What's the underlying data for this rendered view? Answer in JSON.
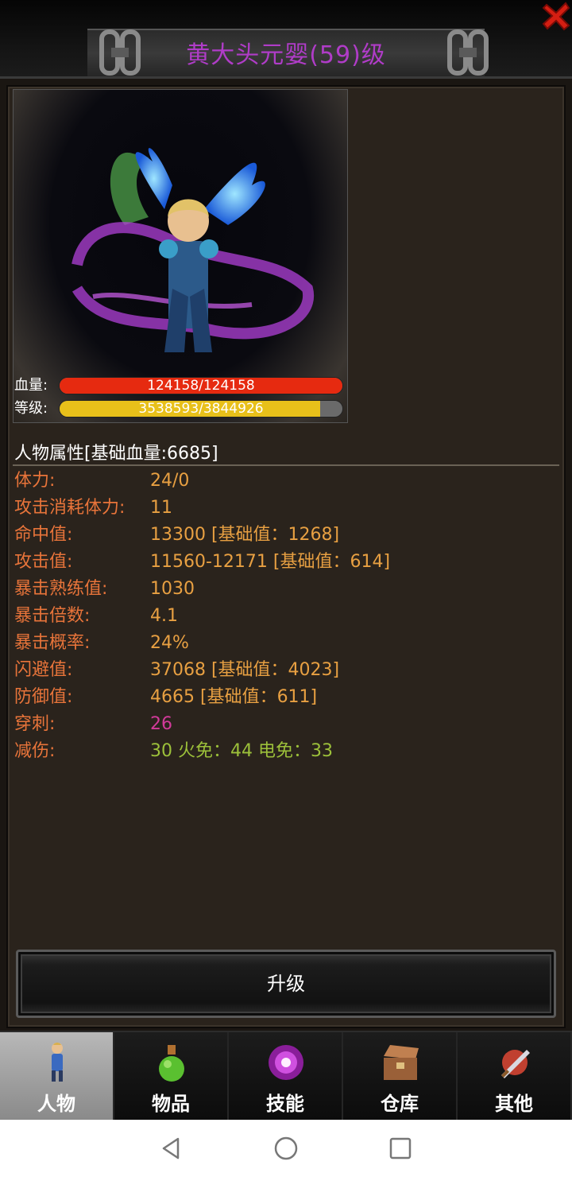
{
  "header": {
    "title": "黄大头元婴(59)级",
    "close_icon": "close-x-icon"
  },
  "portrait": {
    "hp_label": "血量:",
    "hp_text": "124158/124158",
    "hp_fraction": 1.0,
    "level_label": "等级:",
    "exp_text": "3538593/3844926",
    "exp_fraction": 0.92,
    "colors": {
      "hp": "#e62a10",
      "exp": "#e8c01a"
    }
  },
  "attributes": {
    "title": "人物属性[基础血量:6685]",
    "rows": [
      {
        "label": "体力:",
        "value": "24/0",
        "color": "#e8a042"
      },
      {
        "label": "攻击消耗体力:",
        "value": "11",
        "color": "#e8a042"
      },
      {
        "label": "命中值:",
        "value": "13300 [基础值：1268]",
        "color": "#e8a042"
      },
      {
        "label": "攻击值:",
        "value": "11560-12171 [基础值：614]",
        "color": "#e8a042"
      },
      {
        "label": "暴击熟练值:",
        "value": "1030",
        "color": "#e8a042"
      },
      {
        "label": "暴击倍数:",
        "value": "4.1",
        "color": "#e8a042"
      },
      {
        "label": "暴击概率:",
        "value": "24%",
        "color": "#e8a042"
      },
      {
        "label": "闪避值:",
        "value": "37068 [基础值：4023]",
        "color": "#e8a042"
      },
      {
        "label": "防御值:",
        "value": "4665 [基础值：611]",
        "color": "#e8a042"
      },
      {
        "label": "穿刺:",
        "value": "26",
        "color": "#d23a9a"
      },
      {
        "label": "减伤:",
        "value": "30 火免：44 电免：33",
        "color": "#9cc03a"
      }
    ]
  },
  "upgrade_button": {
    "label": "升级"
  },
  "tabs": [
    {
      "label": "人物",
      "icon": "character-icon",
      "active": true
    },
    {
      "label": "物品",
      "icon": "potion-icon",
      "active": false
    },
    {
      "label": "技能",
      "icon": "skill-orb-icon",
      "active": false
    },
    {
      "label": "仓库",
      "icon": "chest-icon",
      "active": false
    },
    {
      "label": "其他",
      "icon": "sword-icon",
      "active": false
    }
  ],
  "system_nav": {
    "back": "back-icon",
    "home": "home-icon",
    "recents": "recents-icon"
  }
}
